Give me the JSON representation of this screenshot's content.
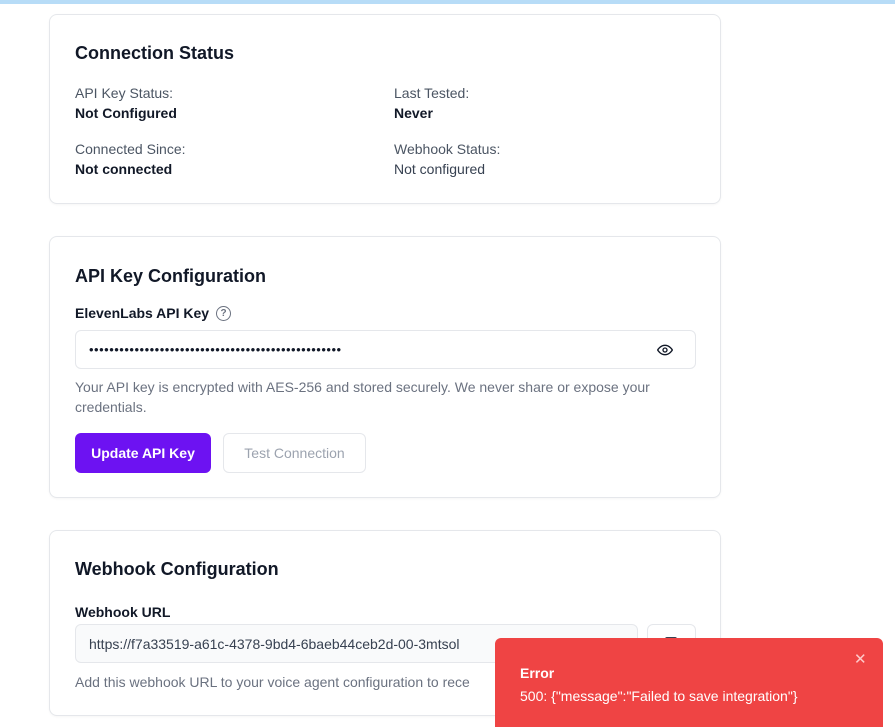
{
  "status": {
    "title": "Connection Status",
    "api_key_status_label": "API Key Status:",
    "api_key_status_value": "Not Configured",
    "last_tested_label": "Last Tested:",
    "last_tested_value": "Never",
    "connected_since_label": "Connected Since:",
    "connected_since_value": "Not connected",
    "webhook_status_label": "Webhook Status:",
    "webhook_status_value": "Not configured"
  },
  "api": {
    "title": "API Key Configuration",
    "field_label": "ElevenLabs API Key",
    "help_icon": "question-circle-icon",
    "masked_value": "••••••••••••••••••••••••••••••••••••••••••••••••••",
    "show_icon": "eye-icon",
    "hint": "Your API key is encrypted with AES-256 and stored securely. We never share or expose your credentials.",
    "update_button": "Update API Key",
    "test_button": "Test Connection"
  },
  "webhook": {
    "title": "Webhook Configuration",
    "url_label": "Webhook URL",
    "url_value": "https://f7a33519-a61c-4378-9bd4-6baeb44ceb2d-00-3mtsol",
    "copy_icon": "copy-icon",
    "hint": "Add this webhook URL to your voice agent configuration to rece"
  },
  "toast": {
    "title": "Error",
    "message": "500: {\"message\":\"Failed to save integration\"}",
    "close_icon": "close-icon"
  },
  "colors": {
    "primary": "#6d12f2",
    "error": "#ef4444"
  }
}
